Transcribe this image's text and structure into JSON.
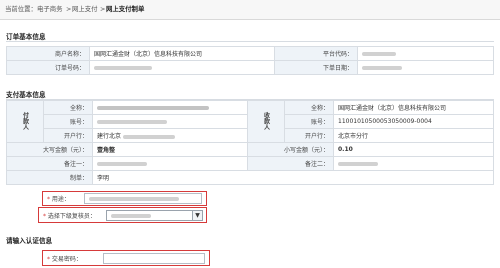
{
  "breadcrumb": {
    "prefix": "当前位置：",
    "items": [
      "电子商务",
      "网上支付",
      "网上支付制单"
    ],
    "sep": ">"
  },
  "order_section": {
    "title": "订单基本信息",
    "merchant_name_label": "商户名称：",
    "merchant_name_value": "国网汇通金财（北京）信息科技有限公司",
    "platform_code_label": "平台代码：",
    "order_no_label": "订单号码：",
    "order_date_label": "下单日期："
  },
  "pay_section": {
    "title": "支付基本信息",
    "payer_title": "付款人",
    "payee_title": "收款人",
    "fullname_label": "全称：",
    "account_label": "账号：",
    "bank_label": "开户行：",
    "payer_bank_value": "建行北京",
    "payee_fullname_value": "国网汇通金财（北京）信息科技有限公司",
    "payee_account_value": "11001010500053050009-0004",
    "payee_bank_value": "北京市分行",
    "amount_upper_label": "大写金额（元）：",
    "amount_upper_value": "壹角整",
    "amount_lower_label": "小写金额（元）：",
    "amount_lower_value": "0.10",
    "remark1_label": "备注一：",
    "remark2_label": "备注二：",
    "createdby_label": "制单：",
    "createdby_value": "李明"
  },
  "form": {
    "usage_label": "用途：",
    "reviewer_label": "选择下级复核员：",
    "required_mark": "*"
  },
  "auth_section": {
    "title": "请输入认证信息",
    "pwd_label": "交易密码："
  },
  "colors": {
    "highlight_border": "#d63a3a",
    "label_bg": "#eef3f8"
  }
}
